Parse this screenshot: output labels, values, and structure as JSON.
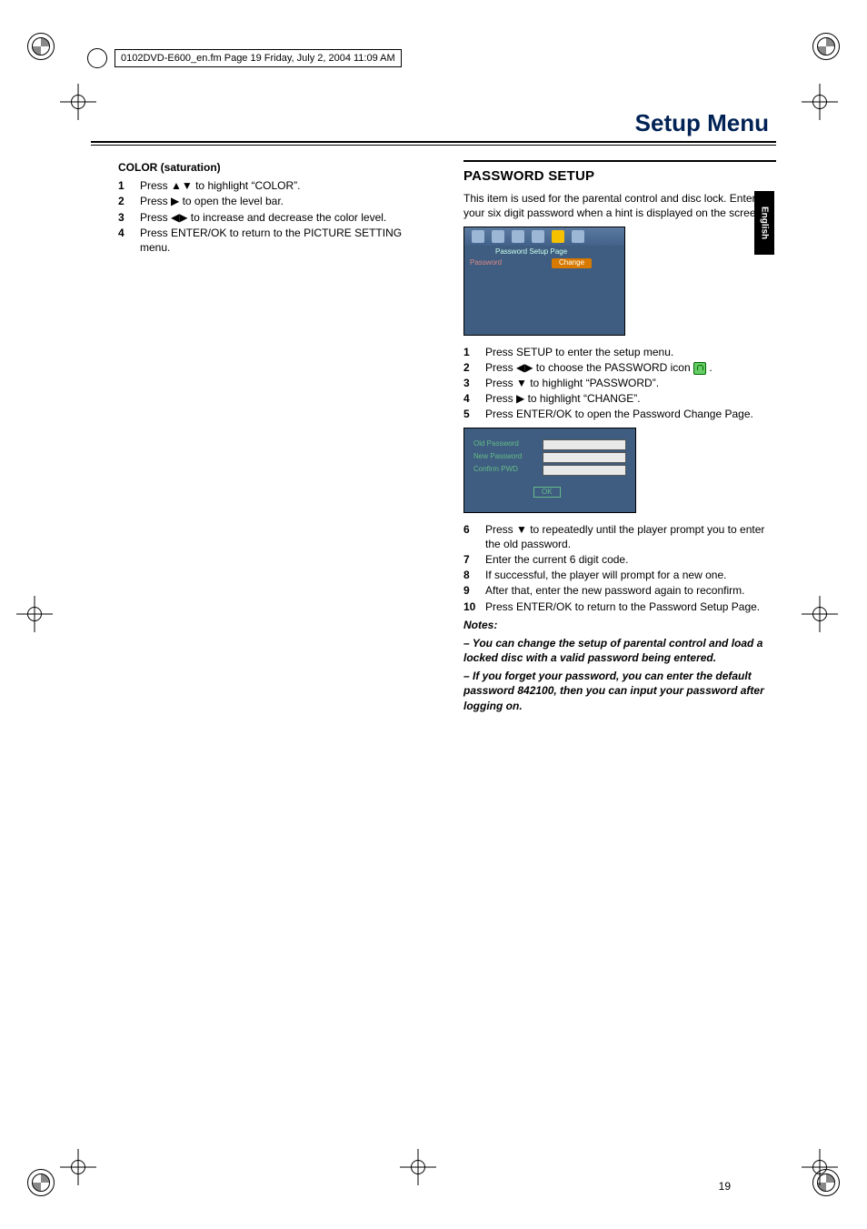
{
  "header_runline": "0102DVD-E600_en.fm  Page 19  Friday, July 2, 2004  11:09 AM",
  "page_title": "Setup Menu",
  "side_tab": "English",
  "page_number": "19",
  "left": {
    "heading": "COLOR (saturation)",
    "steps": [
      "Press ▲▼ to highlight “COLOR”.",
      "Press ▶ to open the level bar.",
      "Press ◀▶ to increase and decrease the color level.",
      "Press ENTER/OK to return to the PICTURE SETTING menu."
    ]
  },
  "right": {
    "heading": "PASSWORD SETUP",
    "intro": "This item is used for the parental control and disc lock. Enter your six digit password when a hint is displayed on the screen.",
    "scr1_title": "Password Setup Page",
    "scr1_label": "Password",
    "scr1_value": "Change",
    "stepsA": [
      "Press SETUP to enter the setup menu.",
      "Press ◀▶ to choose the PASSWORD icon ",
      "Press ▼ to highlight “PASSWORD”.",
      "Press ▶ to highlight “CHANGE”.",
      "Press ENTER/OK to open the Password Change Page."
    ],
    "scr2": {
      "old": "Old Password",
      "new": "New Password",
      "confirm": "Confirm PWD",
      "ok": "OK"
    },
    "stepsB": [
      "Press ▼ to repeatedly until the player prompt you to enter the old password.",
      "Enter the current 6 digit code.",
      "If successful, the player will prompt for a new one.",
      "After that, enter the new password again to reconfirm.",
      "Press ENTER/OK to return to the Password Setup Page."
    ],
    "notes_label": "Notes:",
    "note1": "– You can change the setup of parental control and load a locked disc with a valid password being entered.",
    "note2": "– If you forget your password, you can enter the default password 842100, then you can input your password after logging on."
  }
}
